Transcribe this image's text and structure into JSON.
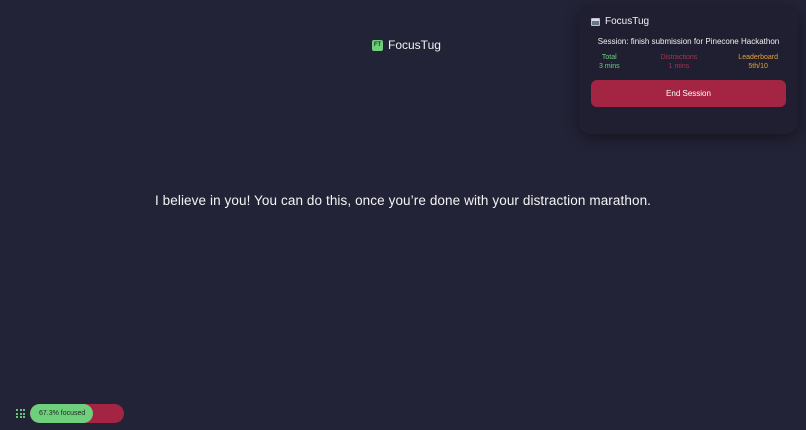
{
  "app": {
    "title": "FocusTug",
    "logo_text": "FT"
  },
  "message": "I believe in you! You can do this, once you’re done with your distraction marathon.",
  "popup": {
    "title": "FocusTug",
    "session_text": "Session: finish submission for Pinecone Hackathon",
    "stats": [
      {
        "label": "Total",
        "value": "3 mins",
        "color": "#6fcf7c"
      },
      {
        "label": "Distractions",
        "value": "1 mins",
        "color": "#a8324a"
      },
      {
        "label": "Leaderboard",
        "value": "5th/10",
        "color": "#e8a13a"
      }
    ],
    "end_button_label": "End Session"
  },
  "focus_bar": {
    "label": "67.3% focused",
    "focused_fraction": 0.673,
    "focused_color": "#6fcf7c",
    "distracted_color": "#a32443"
  },
  "colors": {
    "background": "#232337",
    "card": "#1f1f31",
    "accent_green": "#6fcf7c",
    "accent_red": "#a32443"
  }
}
